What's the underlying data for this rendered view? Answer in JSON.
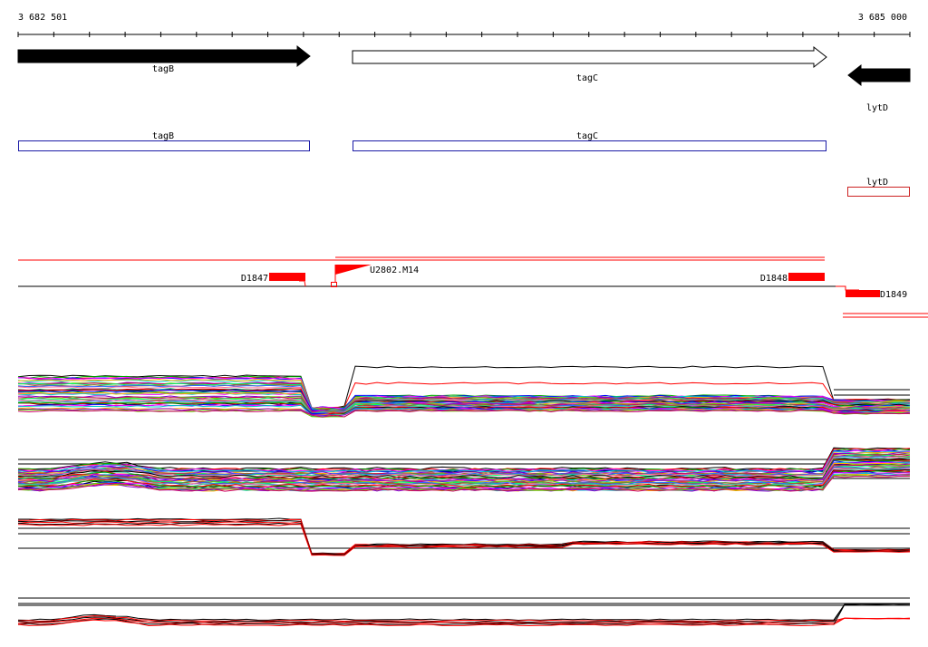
{
  "axis": {
    "start_label": "3 682 501",
    "end_label": "3 685 000",
    "start": 3682501,
    "end": 3685000
  },
  "genes": [
    {
      "name": "tagB",
      "strand": "forward",
      "filled": true,
      "start": 3682501,
      "end": 3683320
    },
    {
      "name": "tagC",
      "strand": "forward",
      "filled": false,
      "start": 3683440,
      "end": 3684770
    },
    {
      "name": "lytD",
      "strand": "reverse",
      "filled": true,
      "start": 3684830,
      "end": 3685000
    }
  ],
  "cds": [
    {
      "name": "tagB",
      "start": 3682501,
      "end": 3683320,
      "color": "#1a1aa6"
    },
    {
      "name": "tagC",
      "start": 3683440,
      "end": 3684770,
      "color": "#1a1aa6"
    },
    {
      "name": "lytD",
      "start": 3684830,
      "end": 3685000,
      "color": "#cc2222"
    }
  ],
  "features": [
    {
      "name": "D1847",
      "start": 3683195,
      "end": 3683300,
      "color": "#ff0000"
    },
    {
      "name": "U2802.M14",
      "start": 3683375,
      "end": 3683470,
      "color": "#ff0000"
    },
    {
      "name": "D1848",
      "start": 3684675,
      "end": 3684775,
      "color": "#ff0000"
    },
    {
      "name": "D1849",
      "start": 3684790,
      "end": 3684895,
      "color": "#ff0000"
    }
  ],
  "colors": {
    "gene_fill": "#000000",
    "cds_stroke": "#1a1aa6",
    "feature": "#ff0000",
    "axis": "#000000"
  }
}
